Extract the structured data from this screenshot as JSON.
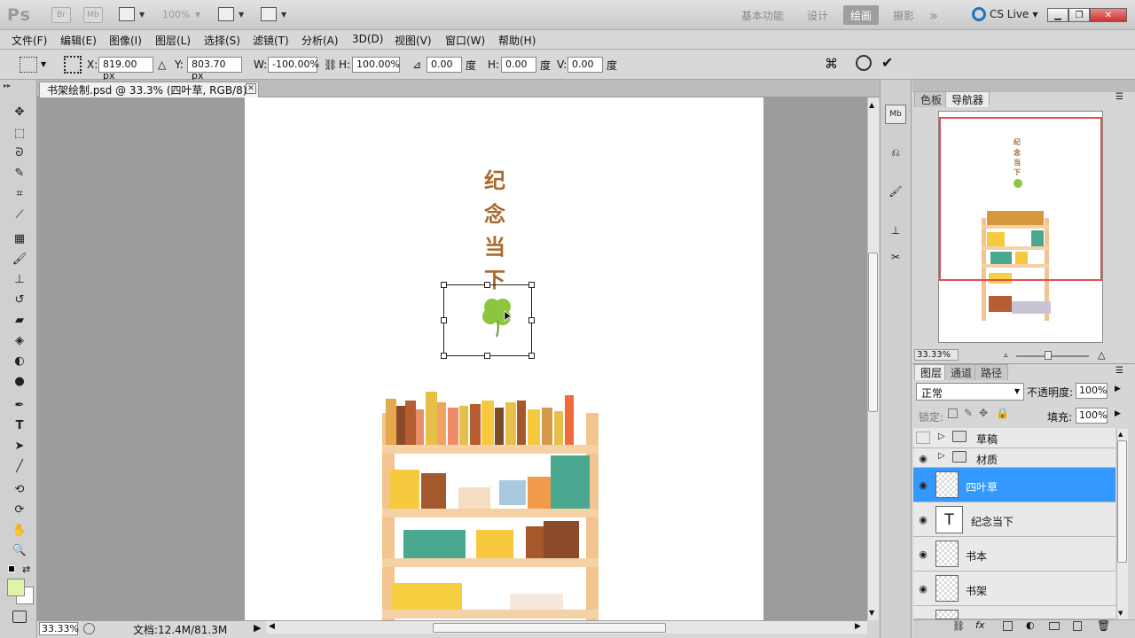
{
  "app": {
    "logo": "Ps",
    "bridge_label": "Br",
    "mini_bridge_label": "Mb",
    "zoom_level": "100%",
    "workspaces": [
      "基本功能",
      "设计",
      "绘画",
      "摄影"
    ],
    "active_workspace": "绘画",
    "more_label": "»",
    "cs_live": "CS Live"
  },
  "menu": [
    "文件(F)",
    "编辑(E)",
    "图像(I)",
    "图层(L)",
    "选择(S)",
    "滤镜(T)",
    "分析(A)",
    "3D(D)",
    "视图(V)",
    "窗口(W)",
    "帮助(H)"
  ],
  "options": {
    "x_label": "X:",
    "x_value": "819.00 px",
    "y_label": "Y:",
    "y_value": "803.70 px",
    "w_label": "W:",
    "w_value": "-100.00%",
    "h_label": "H:",
    "h_value": "100.00%",
    "angle_value": "0.00",
    "angle_unit": "度",
    "hskew_label": "H:",
    "hskew_value": "0.00",
    "hskew_unit": "度",
    "vskew_label": "V:",
    "vskew_value": "0.00",
    "vskew_unit": "度"
  },
  "document": {
    "tab_title": "书架绘制.psd @ 33.3% (四叶草, RGB/8) *",
    "canvas_text": [
      "纪",
      "念",
      "当",
      "下"
    ],
    "zoom": "33.33%",
    "doc_info": "文档:12.4M/81.3M"
  },
  "navigator": {
    "tabs": [
      "色板",
      "导航器"
    ],
    "active_tab": "导航器",
    "zoom": "33.33%"
  },
  "layers": {
    "tabs": [
      "图层",
      "通道",
      "路径"
    ],
    "blend_mode": "正常",
    "opacity_label": "不透明度:",
    "opacity": "100%",
    "lock_label": "锁定:",
    "fill_label": "填充:",
    "fill": "100%",
    "items": [
      {
        "name": "草稿",
        "type": "group",
        "visible": false
      },
      {
        "name": "材质",
        "type": "group",
        "visible": true
      },
      {
        "name": "四叶草",
        "type": "pixel",
        "visible": true,
        "selected": true
      },
      {
        "name": "纪念当下",
        "type": "text",
        "visible": true
      },
      {
        "name": "书本",
        "type": "pixel",
        "visible": true
      },
      {
        "name": "书架",
        "type": "pixel",
        "visible": true
      }
    ],
    "text_thumb_glyph": "T"
  },
  "colors": {
    "selection_blue": "#3399ff",
    "accent_brown": "#a86a2e",
    "clover_green": "#8cc63f",
    "foreground_swatch": "#dcf5a8",
    "navigator_frame": "#e05050"
  }
}
